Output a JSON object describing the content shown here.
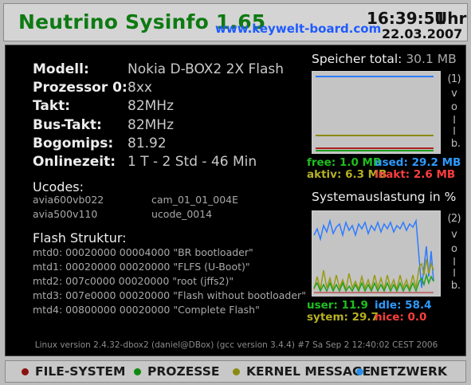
{
  "header": {
    "title": "Neutrino Sysinfo 1.65",
    "url": "www.keywelt-board.com",
    "time": "16:39:51",
    "time_unit": "Uhr",
    "date": "22.03.2007"
  },
  "system": [
    {
      "label": "Modell:",
      "value": "Nokia  D-BOX2   2X Flash"
    },
    {
      "label": "Prozessor  0:",
      "value": "8xx"
    },
    {
      "label": "Takt:",
      "value": "82MHz"
    },
    {
      "label": "Bus-Takt:",
      "value": "82MHz"
    },
    {
      "label": "Bogomips:",
      "value": "81.92"
    },
    {
      "label": "Onlinezeit:",
      "value": "1 T - 2 Std - 46 Min"
    }
  ],
  "ucodes": {
    "title": "Ucodes:",
    "items": [
      "avia600vb022",
      "cam_01_01_004E",
      "avia500v110",
      "ucode_0014"
    ]
  },
  "flash": {
    "title": "Flash Struktur:",
    "items": [
      "mtd0: 00020000 00004000 \"BR bootloader\"",
      "mtd1: 00020000 00020000 \"FLFS (U-Boot)\"",
      "mtd2: 007c0000 00020000 \"root (jffs2)\"",
      "mtd3: 007e0000 00020000 \"Flash without bootloader\"",
      "mtd4: 00800000 00020000 \"Complete Flash\""
    ]
  },
  "memory": {
    "title": "Speicher total:",
    "total": "30.1 MB",
    "side_label": [
      "(",
      "1",
      ")",
      "v",
      "o",
      "l",
      "l",
      "b",
      "."
    ],
    "free": "free: 1.0 MB",
    "used": "used:  29.2 MB",
    "aktiv": "aktiv: 6.3 MB",
    "inakt": "inakt:  2.6 MB"
  },
  "load": {
    "title": "Systemauslastung in %",
    "side_label": [
      "(",
      "2",
      ")",
      "v",
      "o",
      "l",
      "l",
      "b",
      "."
    ],
    "user": "user: 11.9",
    "idle": "idle:  58.4",
    "system": "sytem:  29.7",
    "nice": "nice:  0.0"
  },
  "kernel": "Linux version 2.4.32-dbox2 (daniel@DBox) (gcc version 3.4.4) #7 Sa Sep 2 12:40:02 CEST 2006",
  "footer": [
    {
      "label": "FILE-SYSTEM",
      "color": "#8b1010"
    },
    {
      "label": "PROZESSE",
      "color": "#0e8a0e"
    },
    {
      "label": "KERNEL MESSAGE",
      "color": "#8a8a10"
    },
    {
      "label": "NETZWERK",
      "color": "#2b8fe8"
    }
  ],
  "colors": {
    "title_green": "#0e7a12",
    "url_blue": "#1e5bff",
    "free_green": "#1fbf1f",
    "used_blue": "#2d9bff",
    "aktiv_olive": "#b5b022",
    "inakt_red": "#ff3d3d"
  }
}
